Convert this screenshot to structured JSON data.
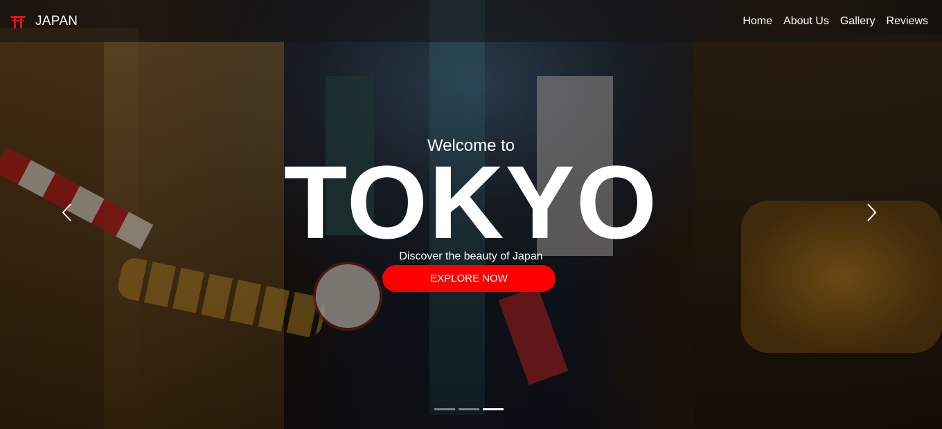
{
  "brand": {
    "name": "JAPAN",
    "icon": "torii-gate-icon",
    "icon_color": "#e01010"
  },
  "nav": {
    "items": [
      "Home",
      "About Us",
      "Gallery",
      "Reviews"
    ]
  },
  "hero": {
    "welcome": "Welcome to",
    "title": "TOKYO",
    "tagline": "Discover the beauty of Japan",
    "cta_label": "EXPLORE NOW",
    "cta_color": "#ff0000"
  },
  "carousel": {
    "slide_count": 3,
    "active_index": 2,
    "prev_icon": "chevron-left-icon",
    "next_icon": "chevron-right-icon"
  }
}
